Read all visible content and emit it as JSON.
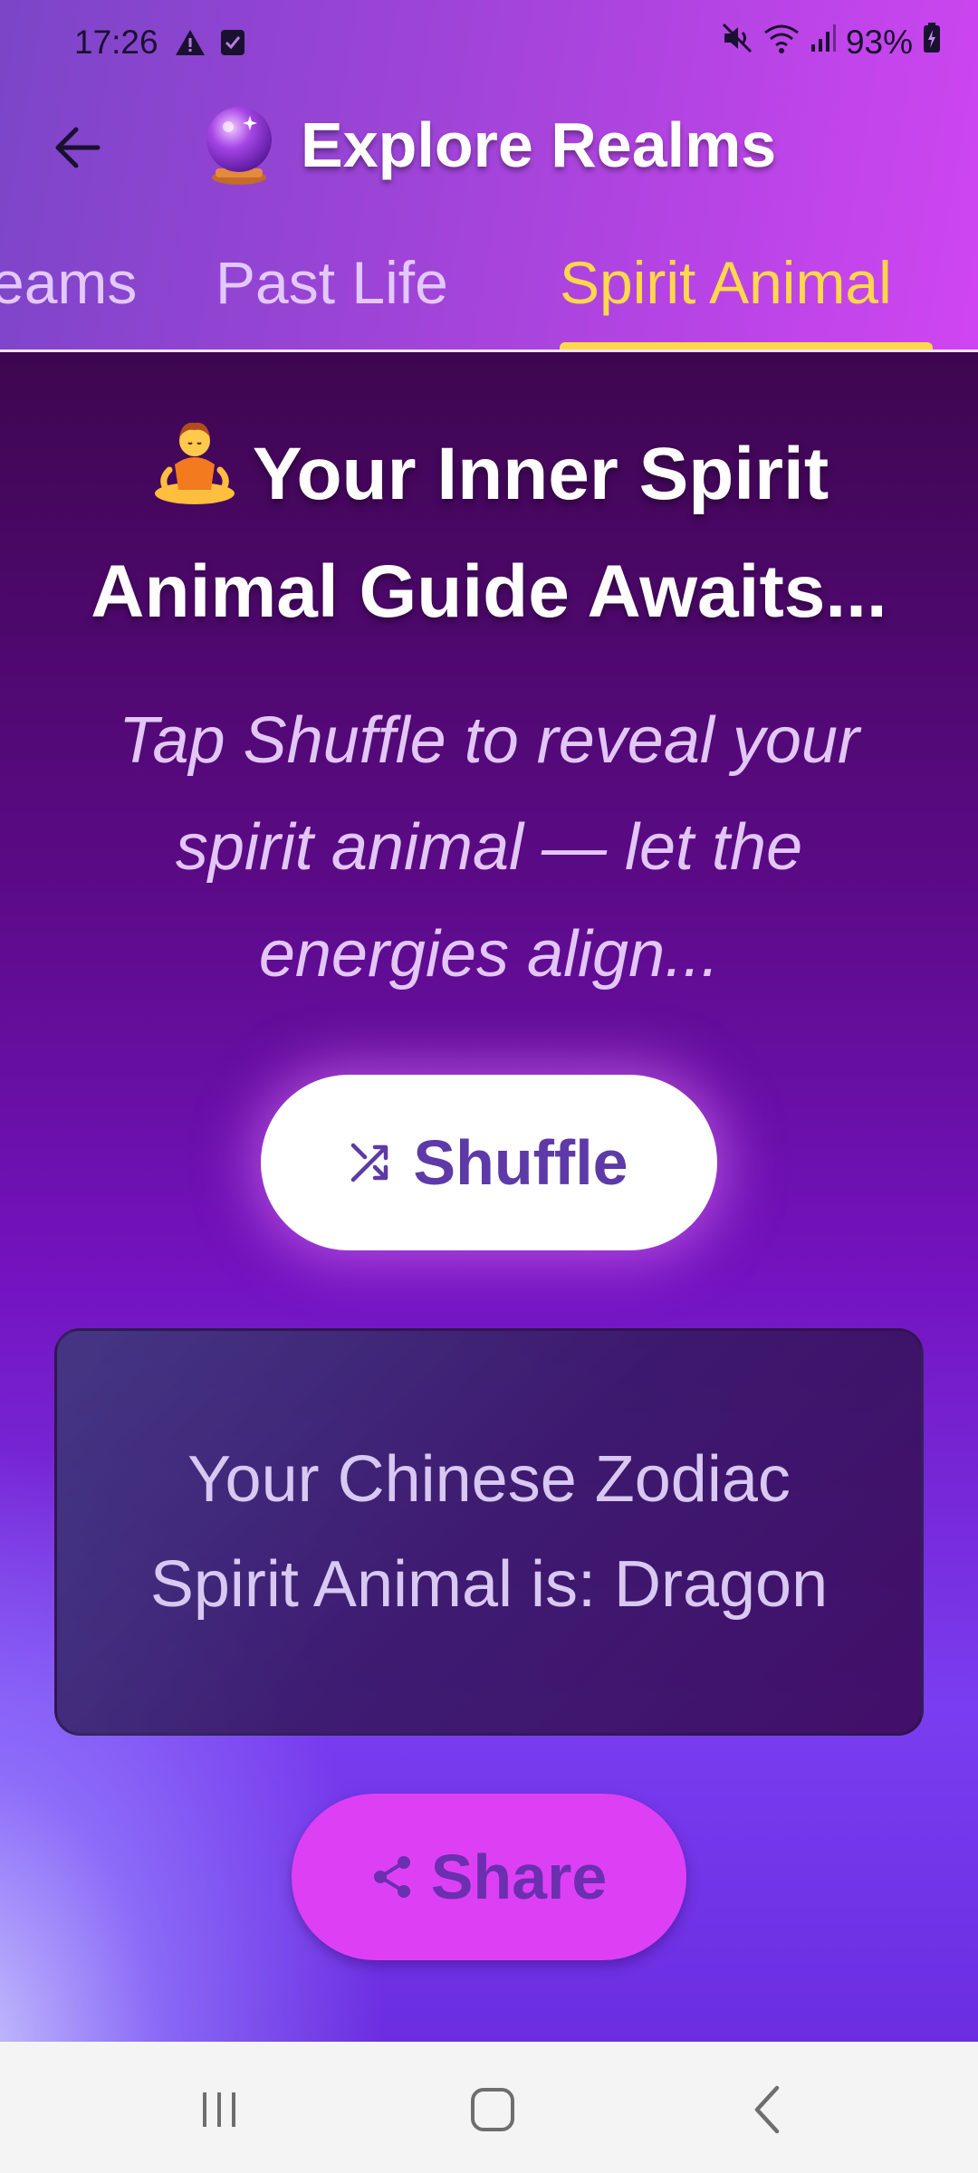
{
  "status_bar": {
    "time": "17:26",
    "battery": "93%"
  },
  "app_bar": {
    "title": "Explore Realms",
    "title_icon": "crystal-ball-icon"
  },
  "tabs": [
    {
      "label": "eams",
      "selected": false
    },
    {
      "label": "Past Life",
      "selected": false
    },
    {
      "label": "Spirit Animal",
      "selected": true
    }
  ],
  "content": {
    "headline": "Your Inner Spirit Animal Guide Awaits...",
    "headline_icon": "meditating-person-emoji",
    "subtitle": "Tap Shuffle to reveal your spirit animal — let the energies align...",
    "shuffle_button": "Shuffle",
    "result": "Your Chinese Zodiac Spirit Animal is: Dragon",
    "share_button": "Share"
  },
  "colors": {
    "accent_tab": "#ffd84a",
    "share_button": "#dd40f4",
    "shuffle_text": "#5d3aa8"
  }
}
